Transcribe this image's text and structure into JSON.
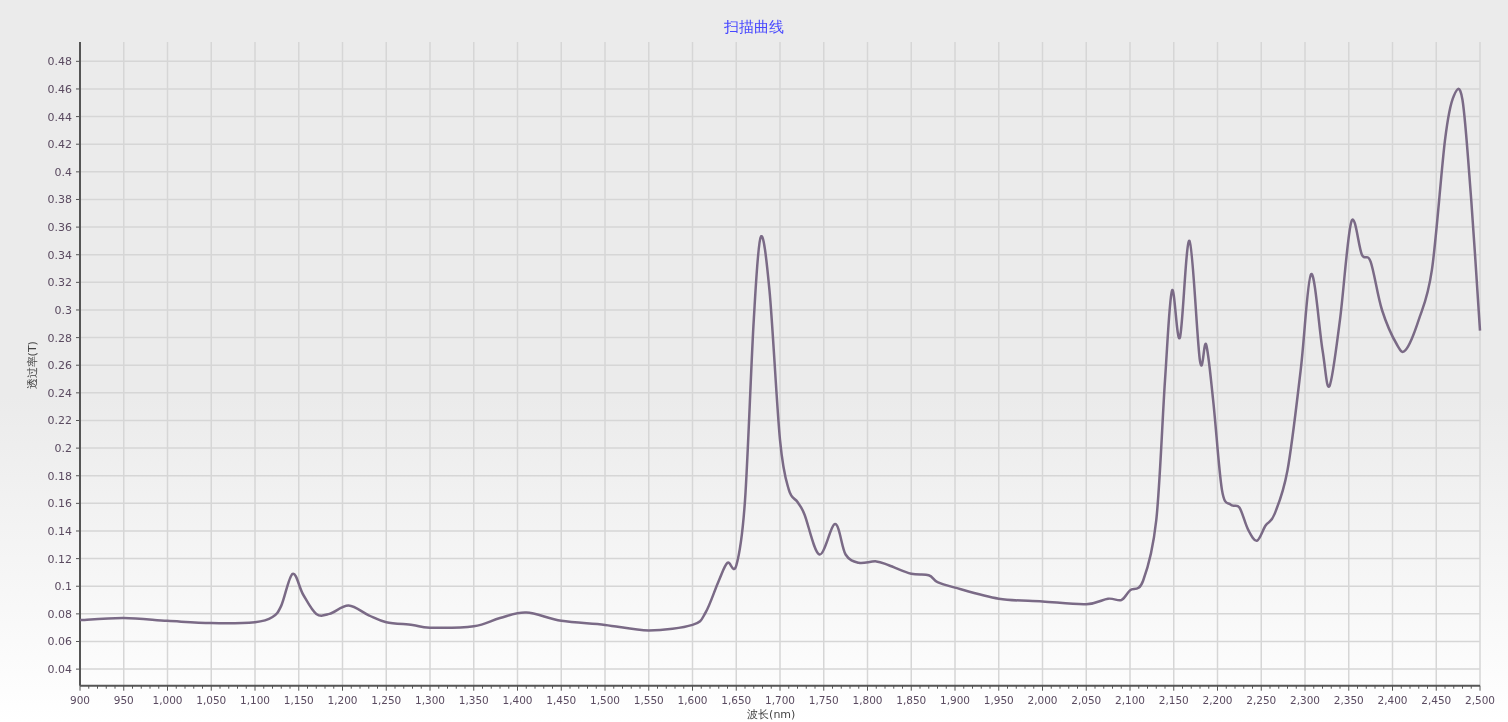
{
  "chart": {
    "chart_data": {
      "type": "line",
      "title": "扫描曲线",
      "grid": true,
      "xlabel": "波长(nm)",
      "ylabel": "透过率(T)",
      "x": [
        900,
        950,
        1000,
        1050,
        1100,
        1120,
        1130,
        1143,
        1155,
        1170,
        1185,
        1207,
        1230,
        1250,
        1280,
        1300,
        1350,
        1380,
        1410,
        1450,
        1500,
        1550,
        1600,
        1615,
        1630,
        1640,
        1650,
        1660,
        1670,
        1678,
        1688,
        1700,
        1710,
        1720,
        1728,
        1745,
        1763,
        1775,
        1790,
        1810,
        1825,
        1850,
        1870,
        1880,
        1900,
        1950,
        2000,
        2050,
        2075,
        2090,
        2100,
        2115,
        2130,
        2140,
        2148,
        2157,
        2168,
        2180,
        2187,
        2195,
        2205,
        2215,
        2225,
        2235,
        2245,
        2255,
        2265,
        2280,
        2295,
        2307,
        2320,
        2328,
        2340,
        2353,
        2365,
        2375,
        2388,
        2405,
        2415,
        2430,
        2445,
        2460,
        2470,
        2480,
        2490,
        2500
      ],
      "series": [
        {
          "color": "#7a6a86",
          "values": [
            0.0755,
            0.077,
            0.075,
            0.0733,
            0.074,
            0.0777,
            0.086,
            0.109,
            0.094,
            0.08,
            0.08,
            0.086,
            0.079,
            0.074,
            0.072,
            0.07,
            0.071,
            0.077,
            0.081,
            0.075,
            0.072,
            0.068,
            0.072,
            0.081,
            0.104,
            0.117,
            0.115,
            0.162,
            0.293,
            0.353,
            0.314,
            0.206,
            0.17,
            0.161,
            0.152,
            0.123,
            0.145,
            0.123,
            0.117,
            0.118,
            0.115,
            0.109,
            0.108,
            0.103,
            0.099,
            0.091,
            0.089,
            0.087,
            0.091,
            0.09,
            0.097,
            0.104,
            0.148,
            0.249,
            0.314,
            0.28,
            0.35,
            0.263,
            0.275,
            0.235,
            0.17,
            0.159,
            0.157,
            0.141,
            0.133,
            0.144,
            0.152,
            0.184,
            0.256,
            0.326,
            0.271,
            0.245,
            0.293,
            0.364,
            0.34,
            0.335,
            0.3,
            0.275,
            0.271,
            0.293,
            0.329,
            0.423,
            0.455,
            0.452,
            0.379,
            0.285
          ]
        }
      ],
      "xlim": [
        900,
        2500
      ],
      "ylim": [
        0.028,
        0.494
      ],
      "xticks": [
        900,
        950,
        {
          "value": 1000,
          "label": "1,000"
        },
        {
          "value": 1050,
          "label": "1,050"
        },
        {
          "value": 1100,
          "label": "1,100"
        },
        {
          "value": 1150,
          "label": "1,150"
        },
        {
          "value": 1200,
          "label": "1,200"
        },
        {
          "value": 1250,
          "label": "1,250"
        },
        {
          "value": 1300,
          "label": "1,300"
        },
        {
          "value": 1350,
          "label": "1,350"
        },
        {
          "value": 1400,
          "label": "1,400"
        },
        {
          "value": 1450,
          "label": "1,450"
        },
        {
          "value": 1500,
          "label": "1,500"
        },
        {
          "value": 1550,
          "label": "1,550"
        },
        {
          "value": 1600,
          "label": "1,600"
        },
        {
          "value": 1650,
          "label": "1,650"
        },
        {
          "value": 1700,
          "label": "1,700"
        },
        {
          "value": 1750,
          "label": "1,750"
        },
        {
          "value": 1800,
          "label": "1,800"
        },
        {
          "value": 1850,
          "label": "1,850"
        },
        {
          "value": 1900,
          "label": "1,900"
        },
        {
          "value": 1950,
          "label": "1,950"
        },
        {
          "value": 2000,
          "label": "2,000"
        },
        {
          "value": 2050,
          "label": "2,050"
        },
        {
          "value": 2100,
          "label": "2,100"
        },
        {
          "value": 2150,
          "label": "2,150"
        },
        {
          "value": 2200,
          "label": "2,200"
        },
        {
          "value": 2250,
          "label": "2,250"
        },
        {
          "value": 2300,
          "label": "2,300"
        },
        {
          "value": 2350,
          "label": "2,350"
        },
        {
          "value": 2400,
          "label": "2,400"
        },
        {
          "value": 2450,
          "label": "2,450"
        },
        {
          "value": 2500,
          "label": "2,500"
        }
      ],
      "yticks": [
        0.04,
        0.06,
        0.08,
        {
          "value": 0.1,
          "label": "0.1"
        },
        0.12,
        0.14,
        0.16,
        0.18,
        {
          "value": 0.2,
          "label": "0.2"
        },
        0.22,
        0.24,
        0.26,
        0.28,
        {
          "value": 0.3,
          "label": "0.3"
        },
        0.32,
        0.34,
        0.36,
        0.38,
        {
          "value": 0.4,
          "label": "0.4"
        },
        0.42,
        0.44,
        0.46,
        0.48
      ]
    }
  }
}
